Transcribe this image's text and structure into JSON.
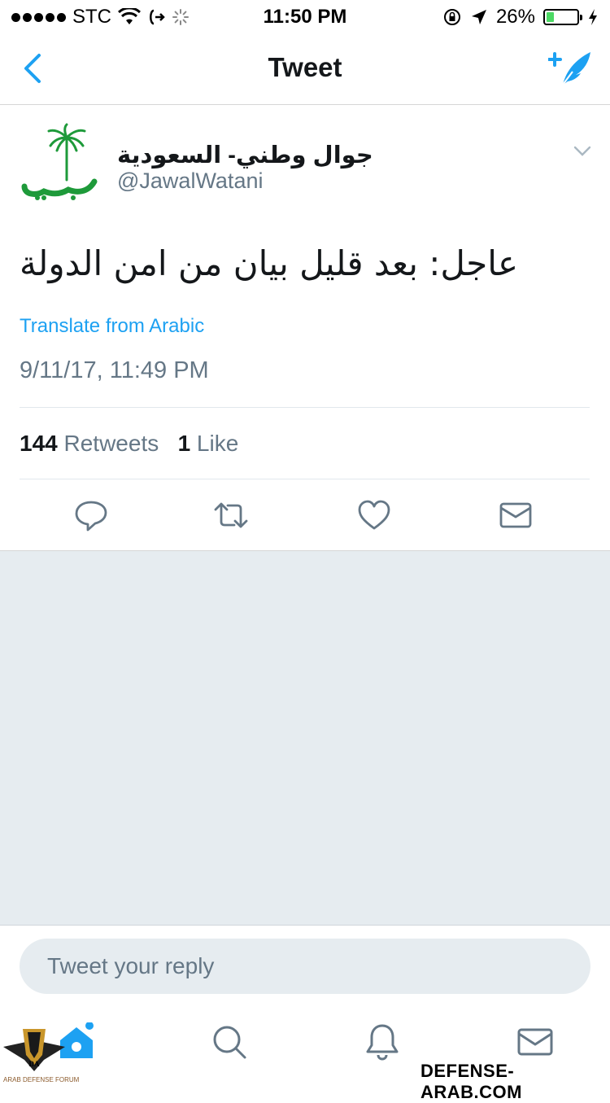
{
  "status_bar": {
    "carrier": "STC",
    "time": "11:50 PM",
    "battery_percent": "26%",
    "battery_level": 0.26
  },
  "nav": {
    "title": "Tweet"
  },
  "tweet": {
    "display_name": "جوال وطني- السعودية",
    "handle": "@JawalWatani",
    "text": "عاجل: بعد قليل بيان من امن الدولة",
    "translate_label": "Translate from Arabic",
    "timestamp": "9/11/17, 11:49 PM",
    "retweets_count": "144",
    "retweets_label": "Retweets",
    "likes_count": "1",
    "likes_label": "Like"
  },
  "reply": {
    "placeholder": "Tweet your reply"
  },
  "watermark": {
    "site": "DEFENSE-ARAB.COM",
    "forum": "ARAB DEFENSE FORUM"
  },
  "colors": {
    "accent": "#1da1f2",
    "muted": "#657786",
    "background_grey": "#e6ecf0",
    "battery_green": "#4cd964"
  }
}
